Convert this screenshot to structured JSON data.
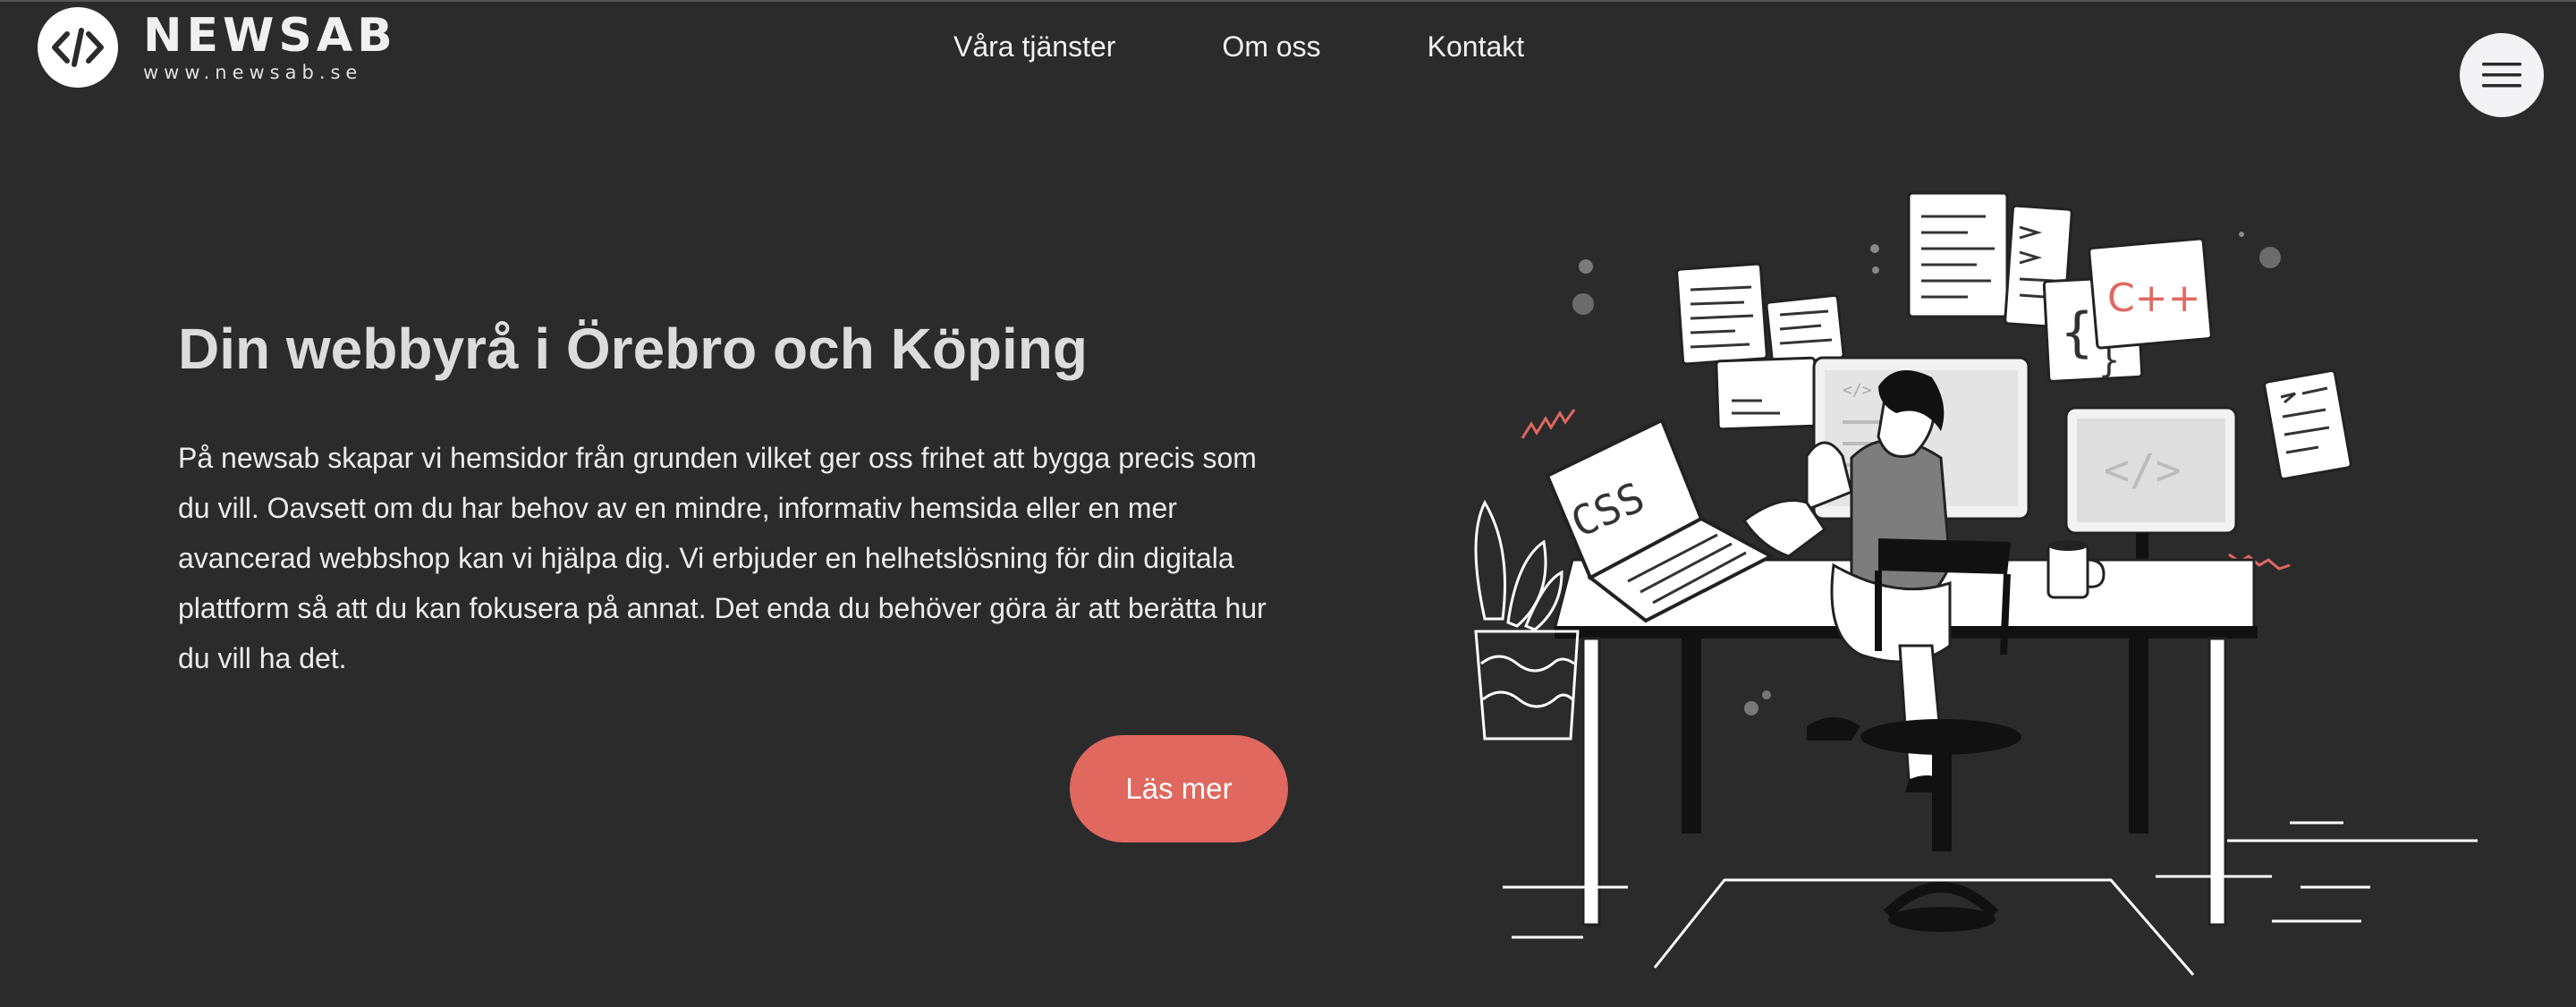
{
  "header": {
    "logo_name": "NEWSAB",
    "logo_url": "www.newsab.se",
    "nav": [
      {
        "label": "Våra tjänster"
      },
      {
        "label": "Om oss"
      },
      {
        "label": "Kontakt"
      }
    ],
    "menu_icon": "hamburger-menu-icon"
  },
  "hero": {
    "title": "Din webbyrå i Örebro och Köping",
    "text": "På newsab skapar vi hemsidor från grunden vilket ger oss frihet att bygga precis som du vill. Oavsett om du har behov av en mindre, informativ hemsida eller en mer avancerad webbshop kan vi hjälpa dig. Vi erbjuder en helhetslösning för din digitala plattform så att du kan fokusera på annat. Det enda du behöver göra är att berätta hur du vill ha det.",
    "cta_label": "Läs mer"
  },
  "illustration": {
    "laptop_text": "CSS",
    "doc_text": "C++"
  },
  "colors": {
    "background": "#2b2b2b",
    "accent": "#e0685f",
    "title": "#dcdcdc",
    "text": "#ececec"
  }
}
